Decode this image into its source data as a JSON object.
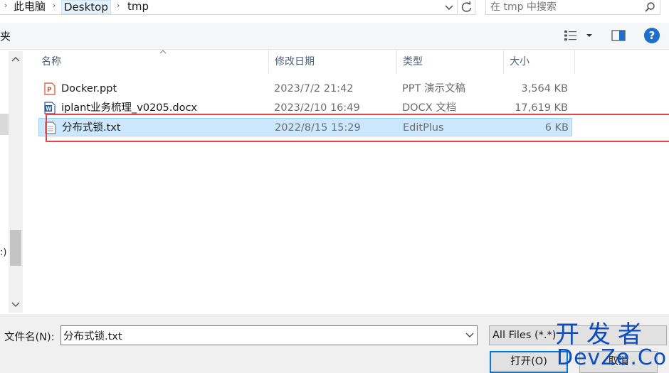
{
  "address": {
    "breadcrumbs": [
      "此电脑",
      "Desktop",
      "tmp"
    ],
    "search_placeholder": "在 tmp 中搜索"
  },
  "commandbar": {
    "left_label": "夹"
  },
  "nav": {
    "partial_text": ":)"
  },
  "columns": {
    "name": "名称",
    "date": "修改日期",
    "type": "类型",
    "size": "大小"
  },
  "files": [
    {
      "name": "Docker.ppt",
      "date": "2023/7/2 21:42",
      "type": "PPT 演示文稿",
      "size": "3,564 KB",
      "icon": "ppt-file-icon"
    },
    {
      "name": "iplant业务梳理_v0205.docx",
      "date": "2023/2/10 16:49",
      "type": "DOCX 文档",
      "size": "17,619 KB",
      "icon": "word-file-icon"
    },
    {
      "name": "分布式锁.txt",
      "date": "2022/8/15 15:29",
      "type": "EditPlus",
      "size": "6 KB",
      "icon": "text-file-icon",
      "selected": true
    }
  ],
  "bottom": {
    "filename_label": "文件名(N):",
    "filename_value": "分布式锁.txt",
    "filter_label": "All Files (*.*)",
    "open_label": "打开(O)",
    "cancel_label": "取消"
  },
  "watermark": {
    "line1": "开发者",
    "line2": "DevZe.CoM"
  },
  "colors": {
    "selection": "#cce8ff",
    "highlight_box": "#e8434a",
    "accent": "#0078d7",
    "watermark": "#0a4cc2"
  }
}
